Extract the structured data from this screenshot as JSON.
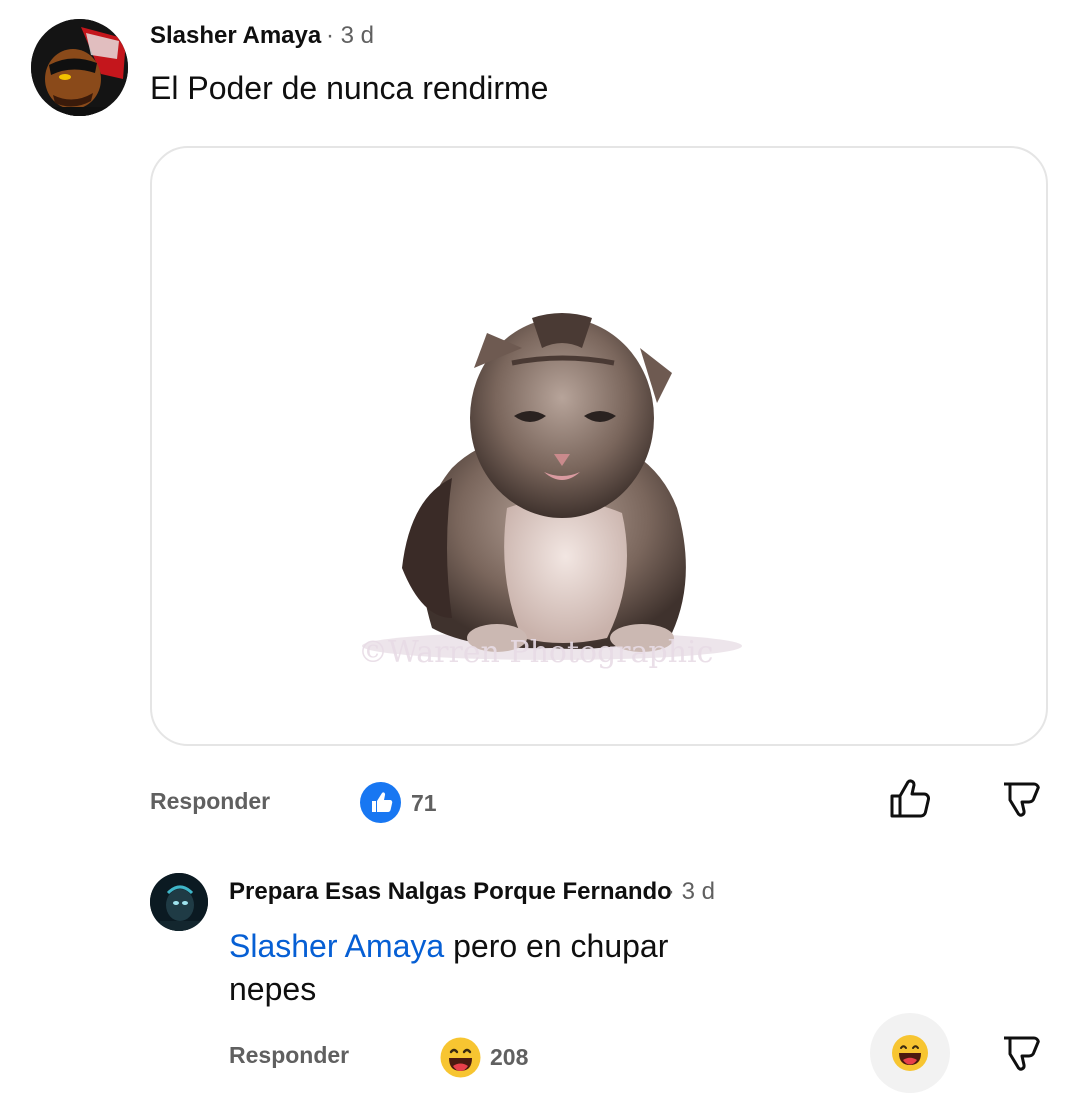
{
  "comment": {
    "author": "Slasher Amaya",
    "time": "· 3 d",
    "text": "El Poder de nunca rendirme",
    "image_watermark": "©Warren Photographic",
    "reply_label": "Responder",
    "reaction_icon": "thumbs-up-icon",
    "reaction_count": "71"
  },
  "reply": {
    "author": "Prepara Esas Nalgas Porque Fernando",
    "time": "· 3 d",
    "mention": "Slasher Amaya",
    "text": " pero en chupar nepes",
    "reply_label": "Responder",
    "reaction_icon": "laughing-emoji-icon",
    "reaction_count": "208"
  },
  "colors": {
    "mention": "#065fd4",
    "like_reaction": "#1877f2",
    "secondary_text": "#606060"
  }
}
